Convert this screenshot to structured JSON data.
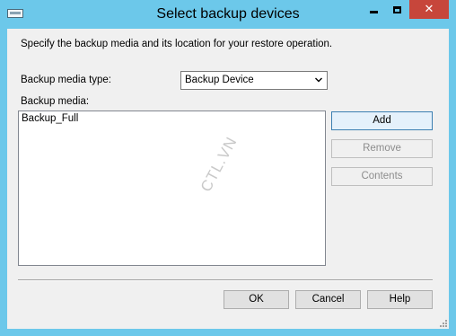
{
  "window": {
    "title": "Select backup devices",
    "icon": "window-menu-icon",
    "controls": {
      "minimize": "minimize-icon",
      "maximize": "maximize-icon",
      "close": "close-icon",
      "close_glyph": "✕",
      "close_color": "#c7463b"
    },
    "frame_color": "#6cc8ea"
  },
  "dialog": {
    "instruction": "Specify the backup media and its location for your restore operation.",
    "media_type_label": "Backup media type:",
    "media_type_value": "Backup Device",
    "media_label": "Backup media:",
    "media_items": [
      "Backup_Full"
    ],
    "buttons": {
      "add": "Add",
      "remove": "Remove",
      "contents": "Contents",
      "ok": "OK",
      "cancel": "Cancel",
      "help": "Help"
    },
    "watermark": "CTL.VN"
  }
}
